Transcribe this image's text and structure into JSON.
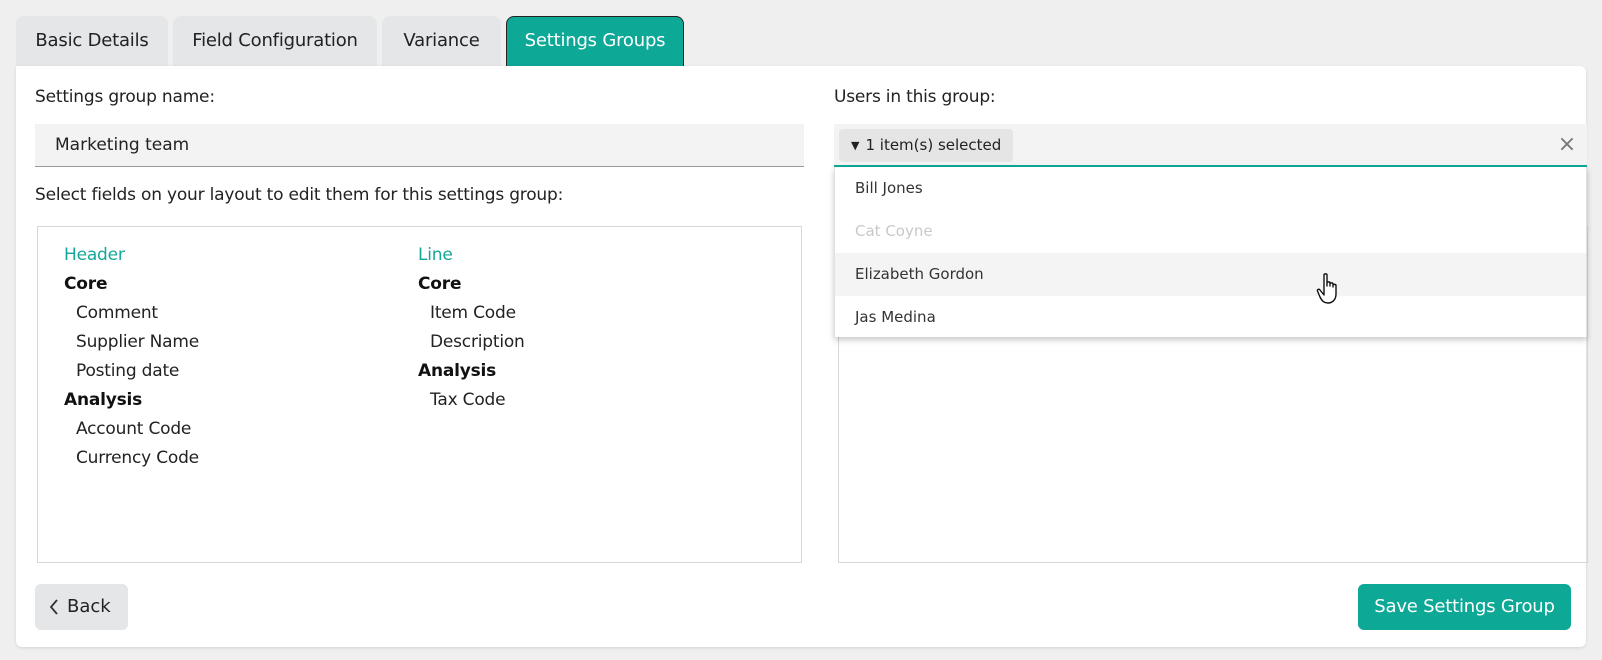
{
  "tabs": [
    {
      "label": "Basic Details",
      "active": false
    },
    {
      "label": "Field Configuration",
      "active": false
    },
    {
      "label": "Variance",
      "active": false
    },
    {
      "label": "Settings Groups",
      "active": true
    }
  ],
  "settings_group": {
    "name_label": "Settings group name:",
    "name_value": "Marketing team",
    "fields_instruction": "Select fields on your layout to edit them for this settings group:"
  },
  "fields": {
    "header": {
      "title": "Header",
      "core_label": "Core",
      "core_fields": [
        "Comment",
        "Supplier Name",
        "Posting date"
      ],
      "analysis_label": "Analysis",
      "analysis_fields": [
        "Account Code",
        "Currency Code"
      ]
    },
    "line": {
      "title": "Line",
      "core_label": "Core",
      "core_fields": [
        "Item Code",
        "Description"
      ],
      "analysis_label": "Analysis",
      "analysis_fields": [
        "Tax Code"
      ]
    }
  },
  "users": {
    "label": "Users in this group:",
    "selected_summary": "1 item(s) selected",
    "clear_glyph": "×",
    "options": [
      {
        "name": "Bill Jones",
        "state": "normal"
      },
      {
        "name": "Cat Coyne",
        "state": "disabled"
      },
      {
        "name": "Elizabeth Gordon",
        "state": "hover"
      },
      {
        "name": "Jas Medina",
        "state": "normal"
      }
    ]
  },
  "actions": {
    "back_label": "Back",
    "save_label": "Save Settings Group"
  },
  "colors": {
    "accent": "#0ea896",
    "accent_text": "#14a898",
    "tab_inactive": "#e5e6e8"
  },
  "icons": {
    "caret": "caret-down-icon",
    "clear": "close-icon",
    "back": "chevron-left-icon",
    "cursor": "hand-pointer-icon"
  }
}
